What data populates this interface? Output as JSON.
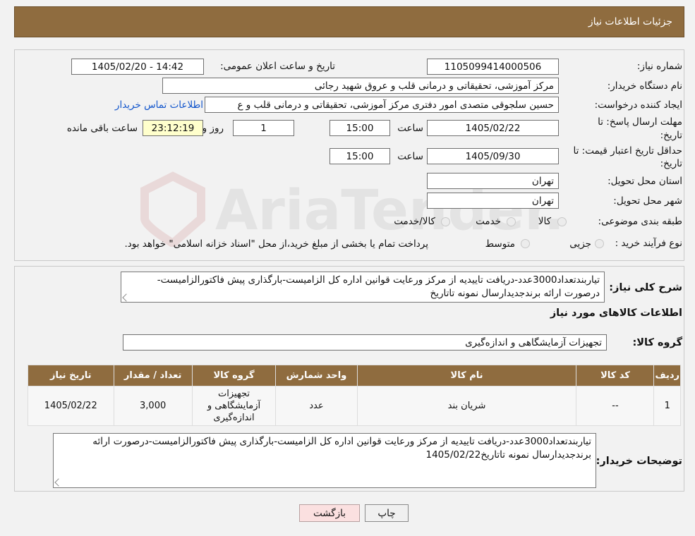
{
  "header": {
    "title": "جزئیات اطلاعات نیاز"
  },
  "need": {
    "number_label": "شماره نیاز:",
    "number_value": "1105099414000506",
    "announce_label": "تاریخ و ساعت اعلان عمومی:",
    "announce_value": "1405/02/20 - 14:42",
    "buyer_label": "نام دستگاه خریدار:",
    "buyer_value": "مرکز آموزشی، تحقیقاتی و درمانی قلب و عروق شهید رجائی",
    "creator_label": "ایجاد کننده درخواست:",
    "creator_value": "حسین سلجوقی متصدی امور دفتری مرکز آموزشی، تحقیقاتی و درمانی قلب و ع",
    "contact_link": "اطلاعات تماس خریدار",
    "deadline_label_1": "مهلت ارسال پاسخ: تا",
    "deadline_label_2": "تاریخ:",
    "deadline_date": "1405/02/22",
    "time_label": "ساعت",
    "deadline_time": "15:00",
    "days_value": "1",
    "days_label": "روز و",
    "remaining_value": "23:12:19",
    "remaining_label": "ساعت باقی مانده",
    "validity_label_1": "حداقل تاریخ اعتبار قیمت: تا",
    "validity_label_2": "تاریخ:",
    "validity_date": "1405/09/30",
    "validity_time": "15:00",
    "province_label": "استان محل تحویل:",
    "province_value": "تهران",
    "city_label": "شهر محل تحویل:",
    "city_value": "تهران",
    "category_label": "طبقه بندی موضوعی:",
    "category_options": [
      "کالا",
      "خدمت",
      "کالا/خدمت"
    ],
    "process_label": "نوع فرآیند خرید :",
    "process_options": [
      "جزیی",
      "متوسط"
    ],
    "process_note": "پرداخت تمام یا بخشی از مبلغ خرید،از محل \"اسناد خزانه اسلامی\" خواهد بود."
  },
  "description": {
    "label": "شرح کلی نیاز:",
    "text": "تیاربندتعداد3000عدد-دریافت تاییدیه از مرکز ورعایت قوانین اداره کل الزامیست-بارگذاری پیش فاکتورالزامیست-درصورت ارائه برندجدیدارسال نمونه تاتاریخ"
  },
  "goods": {
    "section_title": "اطلاعات کالاهای مورد نیاز",
    "group_label": "گروه کالا:",
    "group_value": "تجهیزات آزمایشگاهی و اندازه‌گیری",
    "columns": [
      "ردیف",
      "کد کالا",
      "نام کالا",
      "واحد شمارش",
      "گروه کالا",
      "تعداد / مقدار",
      "تاریخ نیاز"
    ],
    "rows": [
      {
        "row": "1",
        "code": "--",
        "name": "شریان بند",
        "unit": "عدد",
        "group": "تجهیزات آزمایشگاهی و اندازه‌گیری",
        "qty": "3,000",
        "date": "1405/02/22"
      }
    ]
  },
  "buyer_notes": {
    "label": "توضیحات خریدار:",
    "text": "تیاربندتعداد3000عدد-دریافت تاییدیه از مرکز ورعایت قوانین اداره کل الزامیست-بارگذاری پیش فاکتورالزامیست-درصورت ارائه برندجدیدارسال نمونه تاتاریخ1405/02/22"
  },
  "buttons": {
    "print": "چاپ",
    "back": "بازگشت"
  },
  "watermark": {
    "text": "AriaTender.neT"
  },
  "colors": {
    "header_bg": "#8f6c3f",
    "link": "#1155cc",
    "yellow_field": "#ffffcc",
    "back_button": "#fbe0e0"
  }
}
